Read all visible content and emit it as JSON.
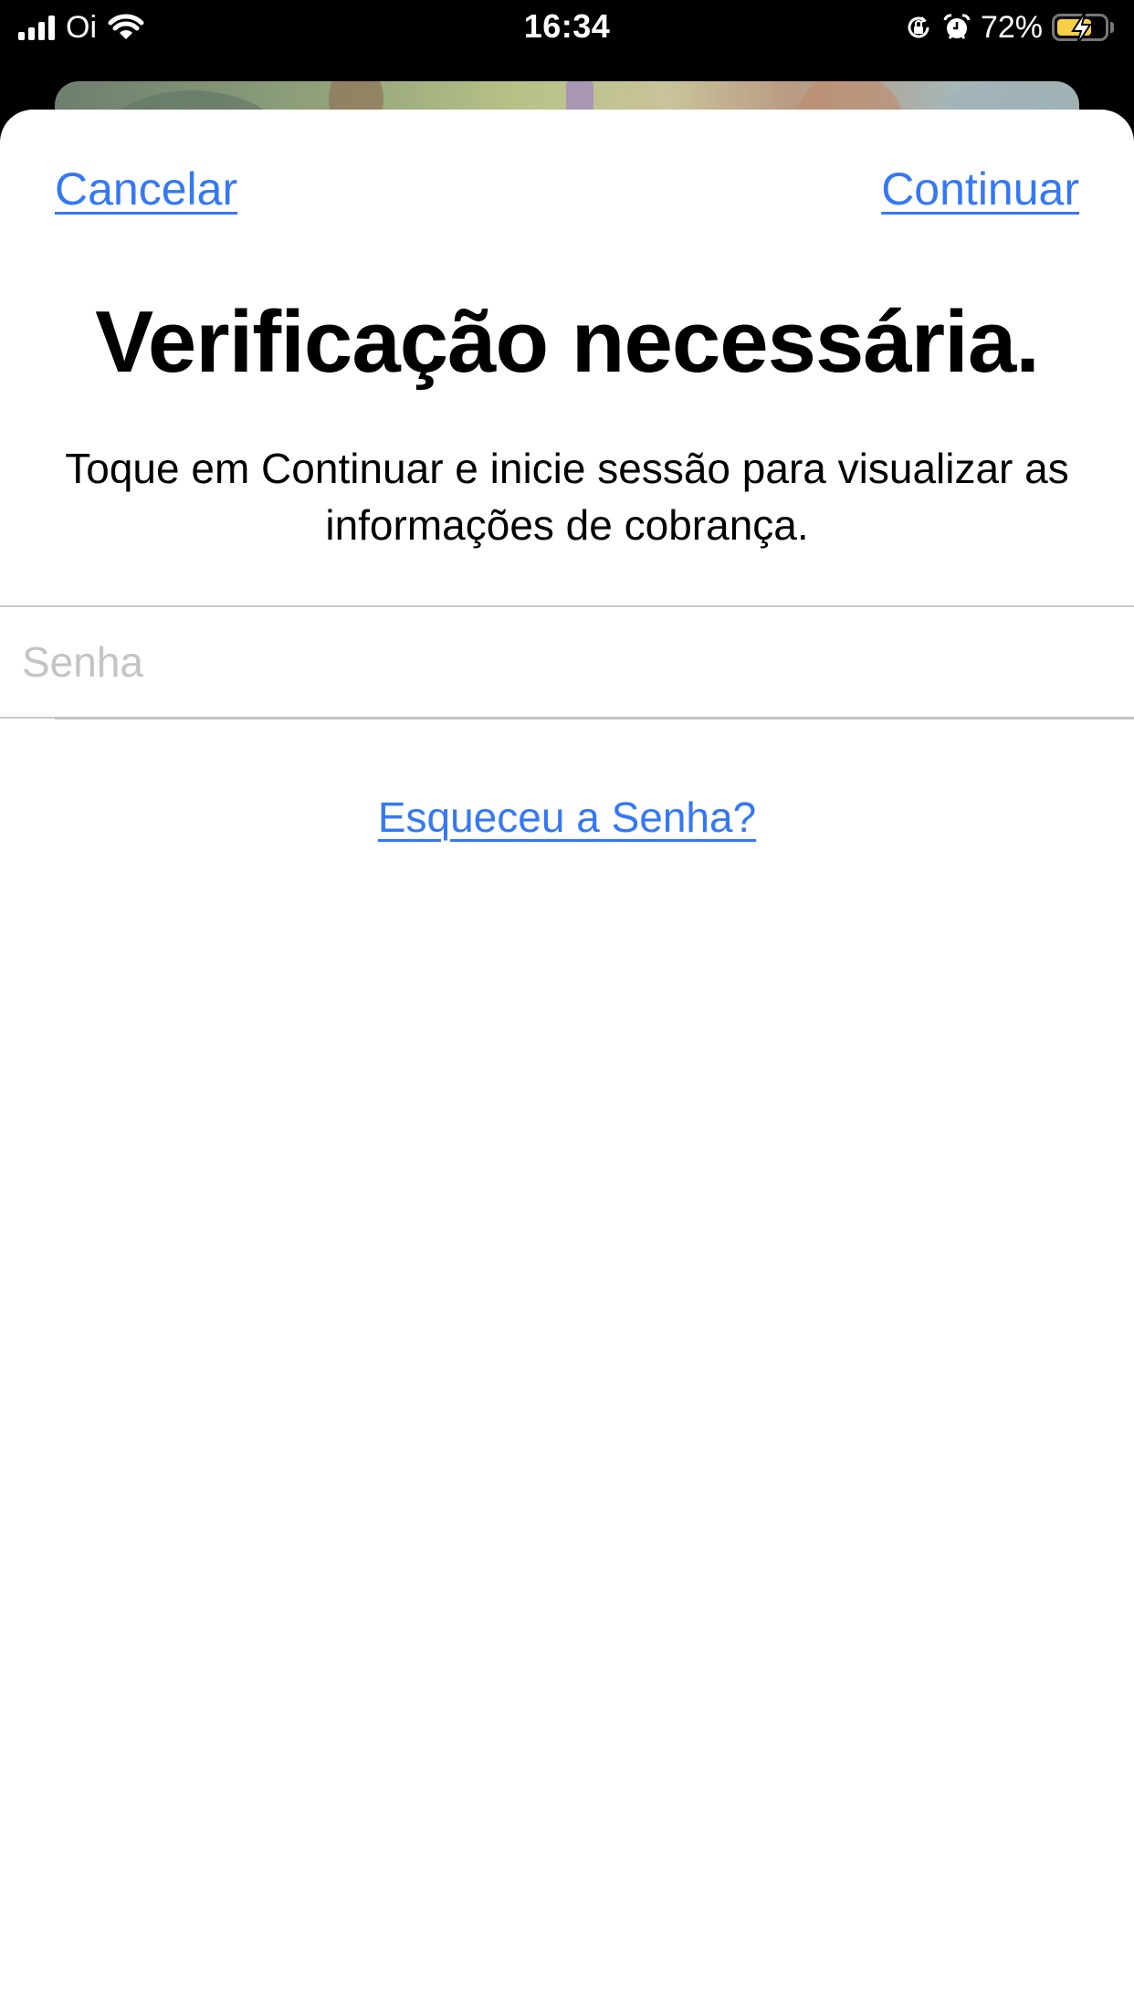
{
  "status_bar": {
    "carrier": "Oi",
    "time": "16:34",
    "battery_percent_label": "72%",
    "battery_level": 0.72,
    "battery_charging": true,
    "icons": [
      "signal-icon",
      "wifi-icon",
      "orientation-lock-icon",
      "alarm-icon",
      "battery-icon"
    ]
  },
  "sheet": {
    "cancel_label": "Cancelar",
    "continue_label": "Continuar",
    "title": "Verificação necessária.",
    "subtitle": "Toque em Continuar e inicie sessão para visualizar as informações de cobrança.",
    "password": {
      "value": "",
      "placeholder": "Senha"
    },
    "forgot_password_label": "Esqueceu a Senha?"
  },
  "colors": {
    "accent": "#3478f6",
    "battery_fill": "#f7cf47",
    "placeholder": "#c4c4c6",
    "separator": "#c8c8cc"
  }
}
